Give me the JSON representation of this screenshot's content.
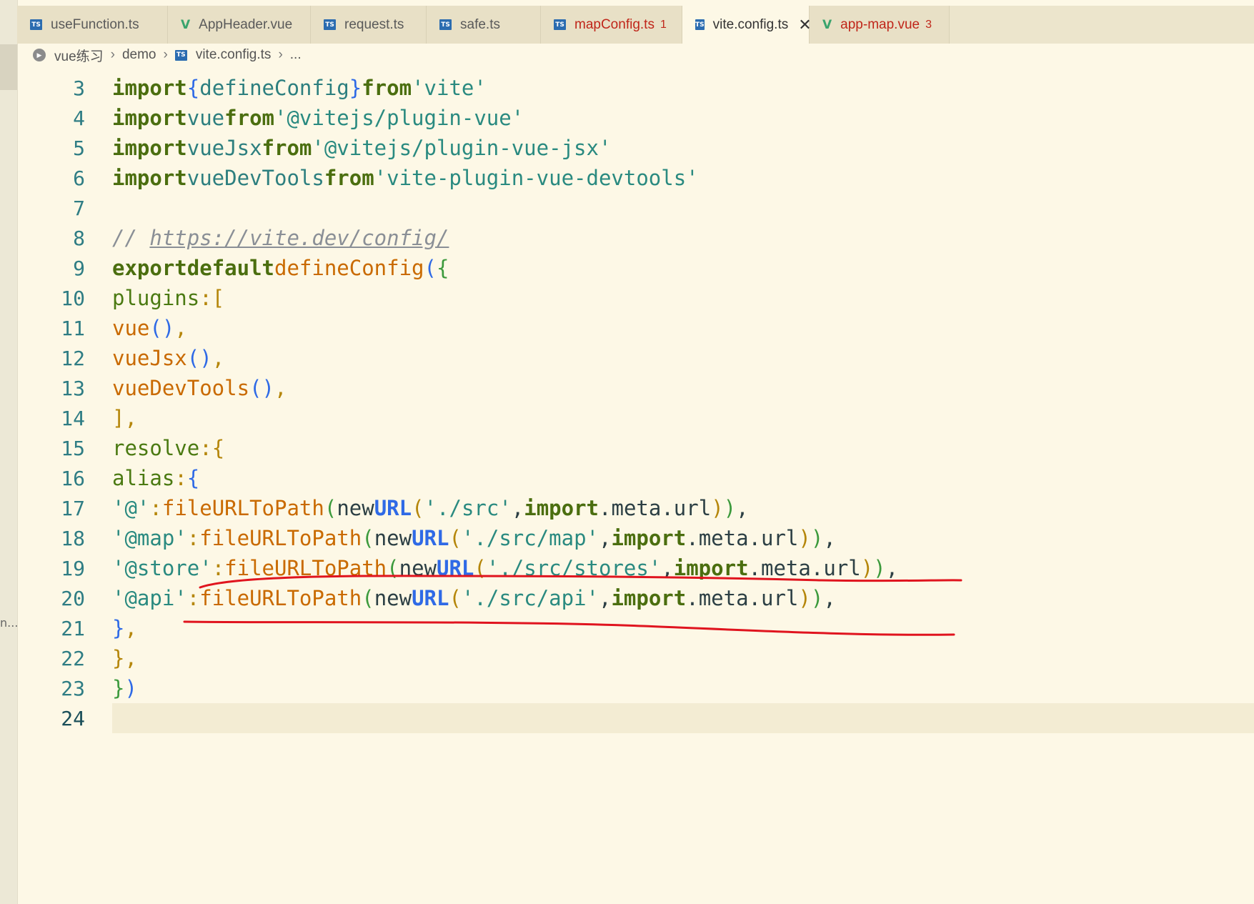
{
  "tabs": [
    {
      "label": "useFunction.ts",
      "icon": "ts-icon",
      "active": false,
      "error": false,
      "badge": ""
    },
    {
      "label": "AppHeader.vue",
      "icon": "vue-icon",
      "active": false,
      "error": false,
      "badge": ""
    },
    {
      "label": "request.ts",
      "icon": "ts-icon",
      "active": false,
      "error": false,
      "badge": ""
    },
    {
      "label": "safe.ts",
      "icon": "ts-icon",
      "active": false,
      "error": false,
      "badge": ""
    },
    {
      "label": "mapConfig.ts",
      "icon": "ts-icon",
      "active": false,
      "error": true,
      "badge": "1"
    },
    {
      "label": "vite.config.ts",
      "icon": "ts-icon",
      "active": true,
      "error": false,
      "badge": "",
      "close": "✕"
    },
    {
      "label": "app-map.vue",
      "icon": "vue-icon",
      "active": false,
      "error": true,
      "badge": "3"
    }
  ],
  "breadcrumb": {
    "root": "vue练习",
    "folder": "demo",
    "file": "vite.config.ts",
    "more": "..."
  },
  "gutter_clip": "n...",
  "editor": {
    "current_line": 24,
    "lines": [
      {
        "n": "3"
      },
      {
        "n": "4"
      },
      {
        "n": "5"
      },
      {
        "n": "6"
      },
      {
        "n": "7"
      },
      {
        "n": "8"
      },
      {
        "n": "9"
      },
      {
        "n": "10"
      },
      {
        "n": "11"
      },
      {
        "n": "12"
      },
      {
        "n": "13"
      },
      {
        "n": "14"
      },
      {
        "n": "15"
      },
      {
        "n": "16"
      },
      {
        "n": "17"
      },
      {
        "n": "18"
      },
      {
        "n": "19"
      },
      {
        "n": "20"
      },
      {
        "n": "21"
      },
      {
        "n": "22"
      },
      {
        "n": "23"
      },
      {
        "n": "24"
      }
    ],
    "tokens": {
      "import": "import",
      "from": "from",
      "export": "export",
      "default": "default",
      "new": "new",
      "URL": "URL",
      "defineConfig": "defineConfig",
      "vue": "vue",
      "vueJsx": "vueJsx",
      "vueDevTools": "vueDevTools",
      "s_vite": "'vite'",
      "s_pluginVue": "'@vitejs/plugin-vue'",
      "s_pluginVueJsx": "'@vitejs/plugin-vue-jsx'",
      "s_devtools": "'vite-plugin-vue-devtools'",
      "comment_slashes": "// ",
      "comment_url": "https://vite.dev/config/",
      "plugins": "plugins",
      "resolve": "resolve",
      "alias": "alias",
      "fileURLToPath": "fileURLToPath",
      "meta": "meta",
      "url": "url",
      "k_at": "'@'",
      "k_map": "'@map'",
      "k_store": "'@store'",
      "k_api": "'@api'",
      "p_src": "'./src'",
      "p_map": "'./src/map'",
      "p_stores": "'./src/stores'",
      "p_api": "'./src/api'"
    }
  },
  "colors": {
    "background": "#fdf8e6",
    "annotation": "#e0141e",
    "error_tab": "#c0261a"
  }
}
